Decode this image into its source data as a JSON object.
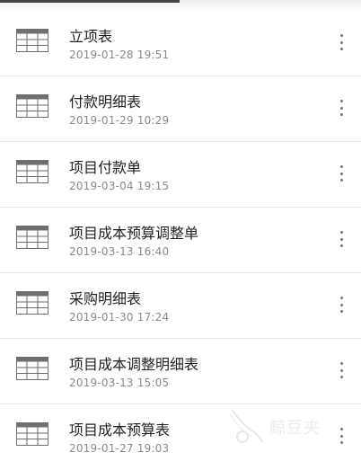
{
  "files": [
    {
      "name": "立项表",
      "date": "2019-01-28 19:51",
      "icon": "spreadsheet-icon"
    },
    {
      "name": "付款明细表",
      "date": "2019-01-29 10:29",
      "icon": "spreadsheet-icon"
    },
    {
      "name": "项目付款单",
      "date": "2019-03-04 19:15",
      "icon": "spreadsheet-icon"
    },
    {
      "name": "项目成本预算调整单",
      "date": "2019-03-13 16:40",
      "icon": "spreadsheet-icon"
    },
    {
      "name": "采购明细表",
      "date": "2019-01-30 17:24",
      "icon": "spreadsheet-icon"
    },
    {
      "name": "项目成本调整明细表",
      "date": "2019-03-13 15:05",
      "icon": "spreadsheet-icon"
    },
    {
      "name": "项目成本预算表",
      "date": "2019-01-27 19:03",
      "icon": "spreadsheet-icon"
    }
  ],
  "watermark": {
    "text": "鲸豆夹"
  },
  "colors": {
    "title": "#222222",
    "date": "#8a8a8a",
    "divider": "#e6e6e6",
    "icon_header": "#6f6f6f"
  }
}
